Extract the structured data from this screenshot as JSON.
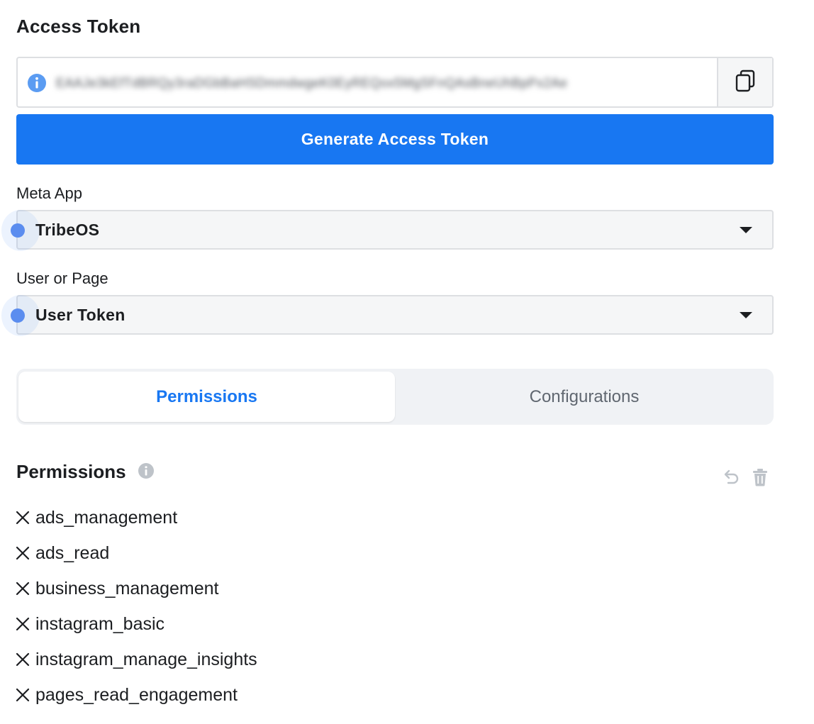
{
  "access_token": {
    "title": "Access Token",
    "token_value": "EAAJe3kEfTdBRQy3raDGbBaHSDmmdwgeK0EyREQox5MgSFnQAsBneUhBpPx2Ae",
    "info_icon": "info-circle-icon",
    "copy_icon": "copy-icon"
  },
  "generate_button": {
    "label": "Generate Access Token",
    "color": "#1877f2"
  },
  "meta_app": {
    "label": "Meta App",
    "selected": "TribeOS"
  },
  "user_or_page": {
    "label": "User or Page",
    "selected": "User Token"
  },
  "tabs": [
    {
      "label": "Permissions",
      "active": true
    },
    {
      "label": "Configurations",
      "active": false
    }
  ],
  "permissions": {
    "title": "Permissions",
    "items": [
      "ads_management",
      "ads_read",
      "business_management",
      "instagram_basic",
      "instagram_manage_insights",
      "pages_read_engagement"
    ],
    "undo_icon": "undo-icon",
    "trash_icon": "trash-icon",
    "remove_icon": "close-x-icon"
  },
  "colors": {
    "accent": "#1877f2",
    "field_border": "#dddfe2",
    "field_bg": "#f5f6f7",
    "tab_bg": "#f0f2f5",
    "muted_icon": "#bec3c9"
  }
}
